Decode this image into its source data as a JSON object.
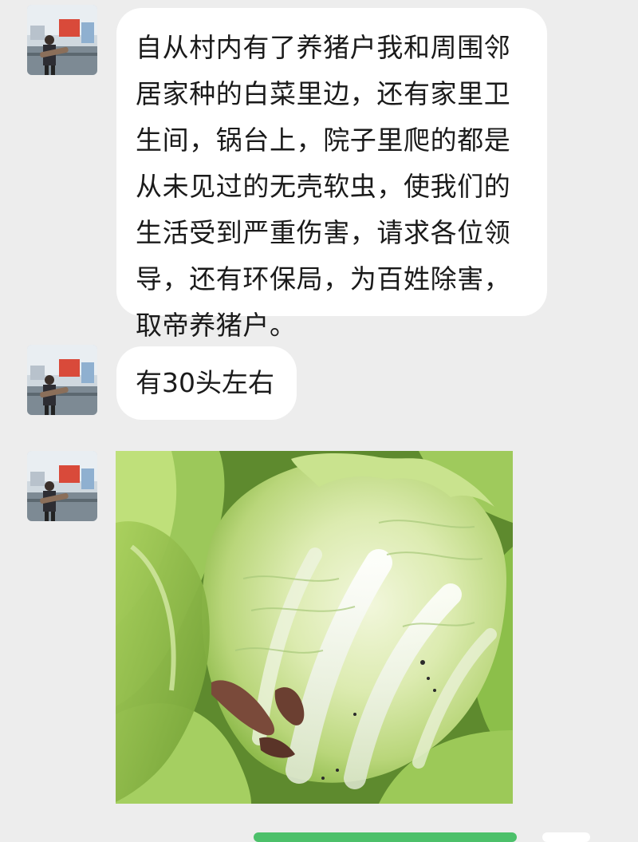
{
  "conversation": {
    "messages": [
      {
        "type": "text",
        "text": "自从村内有了养猪户我和周围邻居家种的白菜里边，还有家里卫生间，锅台上，院子里爬的都是从未见过的无壳软虫，使我们的生活受到严重伤害，请求各位领导，还有环保局，为百姓除害，取帝养猪户。"
      },
      {
        "type": "text",
        "text": "有30头左右"
      },
      {
        "type": "image",
        "subject": "cabbage-photo"
      }
    ]
  },
  "colors": {
    "chat_background": "#ededed",
    "bubble_background": "#ffffff",
    "text": "#1a1a1a",
    "send_green": "#4cc06a"
  }
}
